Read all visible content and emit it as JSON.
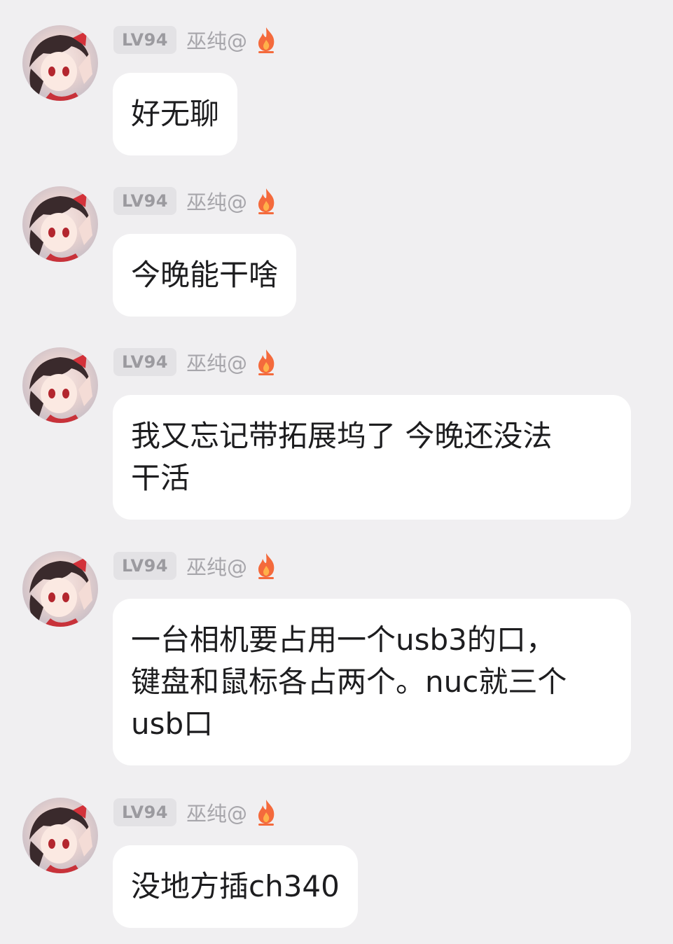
{
  "messages": [
    {
      "level": "LV94",
      "nickname": "巫纯@",
      "text": "好无聊"
    },
    {
      "level": "LV94",
      "nickname": "巫纯@",
      "text": "今晚能干啥"
    },
    {
      "level": "LV94",
      "nickname": "巫纯@",
      "text": "我又忘记带拓展坞了 今晚还没法\n干活"
    },
    {
      "level": "LV94",
      "nickname": "巫纯@",
      "text": "一台相机要占用一个usb3的口，\n键盘和鼠标各占两个。nuc就三个\nusb口"
    },
    {
      "level": "LV94",
      "nickname": "巫纯@",
      "text": "没地方插ch340"
    }
  ],
  "colors": {
    "background": "#f0eff1",
    "bubble": "#ffffff",
    "level_badge": "#e3e2e5",
    "flame": "#f46a3c"
  },
  "icons": {
    "avatar": "anime-girl-avatar-icon",
    "flame": "flame-icon"
  }
}
